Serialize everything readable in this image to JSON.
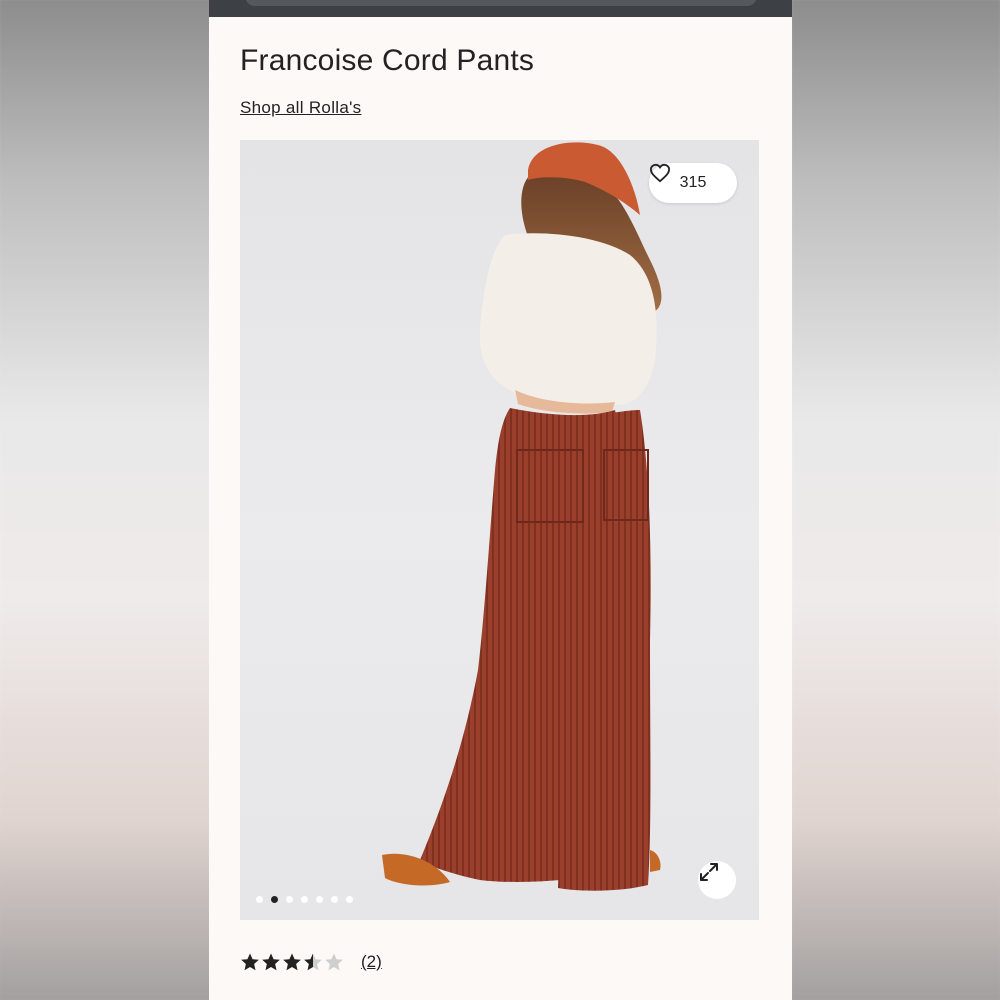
{
  "product": {
    "title": "Francoise Cord Pants",
    "shop_link": "Shop all Rolla's"
  },
  "gallery": {
    "like_count": "315",
    "slide_count": 7,
    "active_slide": 2
  },
  "rating": {
    "value": 3.5,
    "max": 5,
    "review_count_label": "(2)"
  },
  "icons": {
    "like": "heart-outline-icon",
    "expand": "expand-arrows-icon",
    "rating": "star-icon"
  },
  "colors": {
    "background": "#fcf9f7",
    "text": "#222222",
    "pants": "#9b3e2a",
    "cap": "#c95a31",
    "top_bar": "#3d4044"
  }
}
